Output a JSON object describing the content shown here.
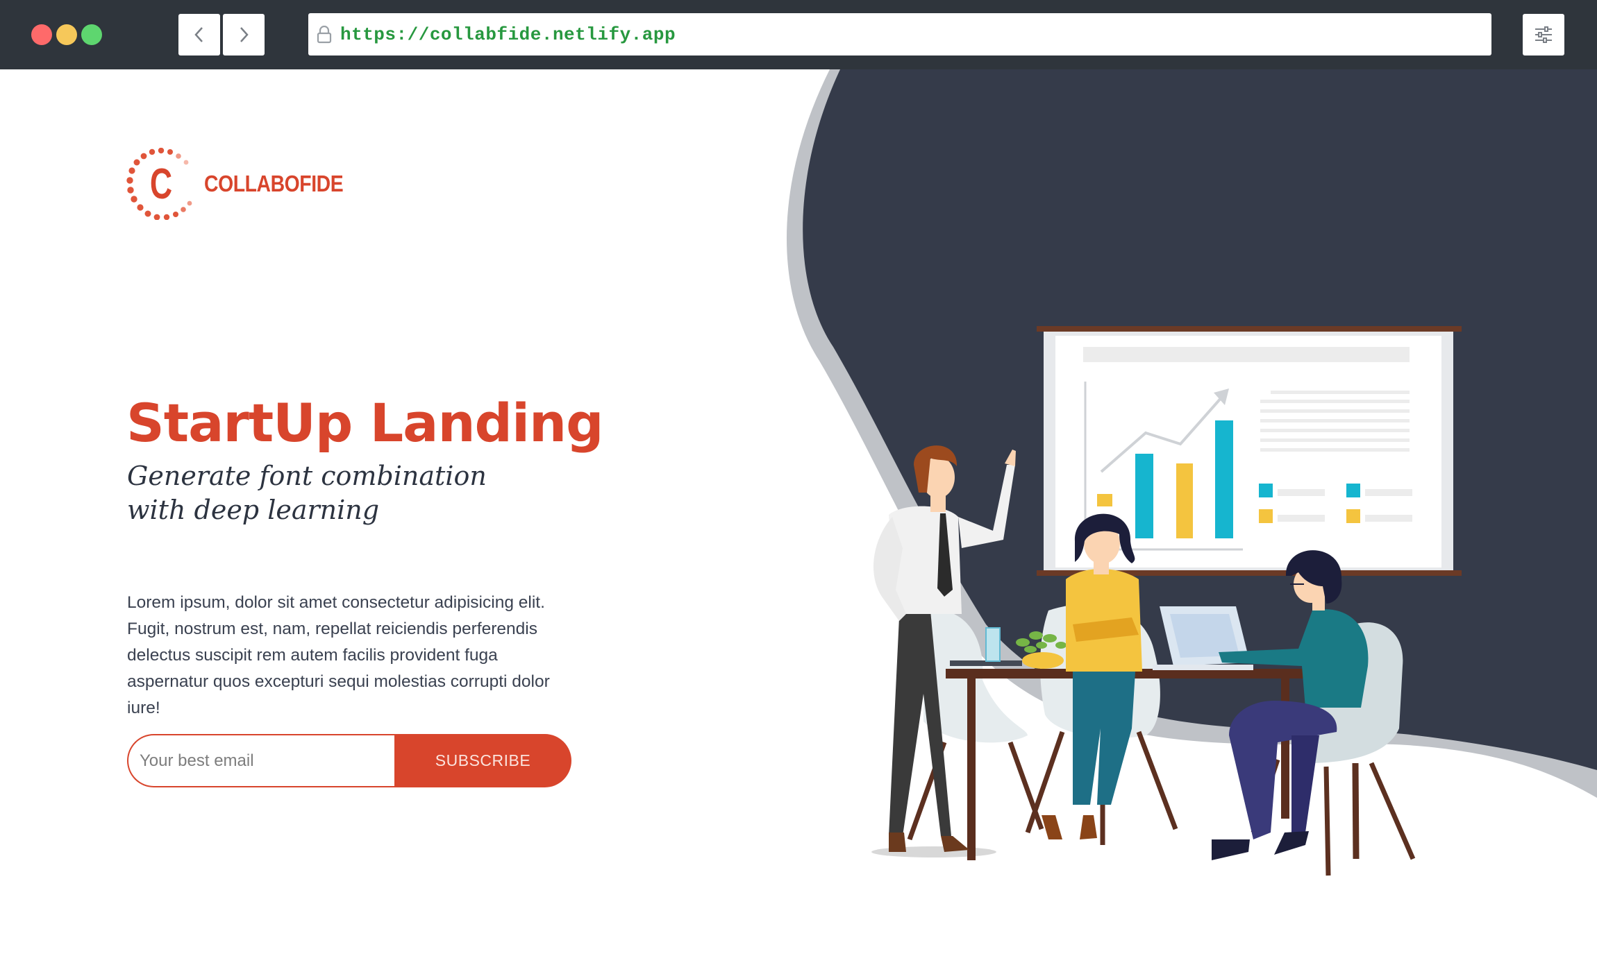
{
  "browser": {
    "url": "https://collabfide.netlify.app"
  },
  "logo": {
    "text": "COLLABOFIDE",
    "letter": "C"
  },
  "hero": {
    "title": "StartUp Landing",
    "subtitle": "Generate font combination with deep learning",
    "body": "Lorem ipsum, dolor sit amet consectetur adipisicing elit. Fugit, nostrum est, nam, repellat reiciendis perferendis delectus suscipit rem autem facilis provident fuga aspernatur quos excepturi sequi molestias corrupti dolor iure!"
  },
  "signup": {
    "email_placeholder": "Your best email",
    "email_value": "",
    "button_label": "SUBSCRIBE"
  },
  "colors": {
    "accent": "#d8452c",
    "dark_panel": "#353b4a",
    "chrome": "#2f353c",
    "url_green": "#27983f"
  },
  "icons": [
    "chevron-left-icon",
    "chevron-right-icon",
    "lock-icon",
    "sliders-icon"
  ]
}
